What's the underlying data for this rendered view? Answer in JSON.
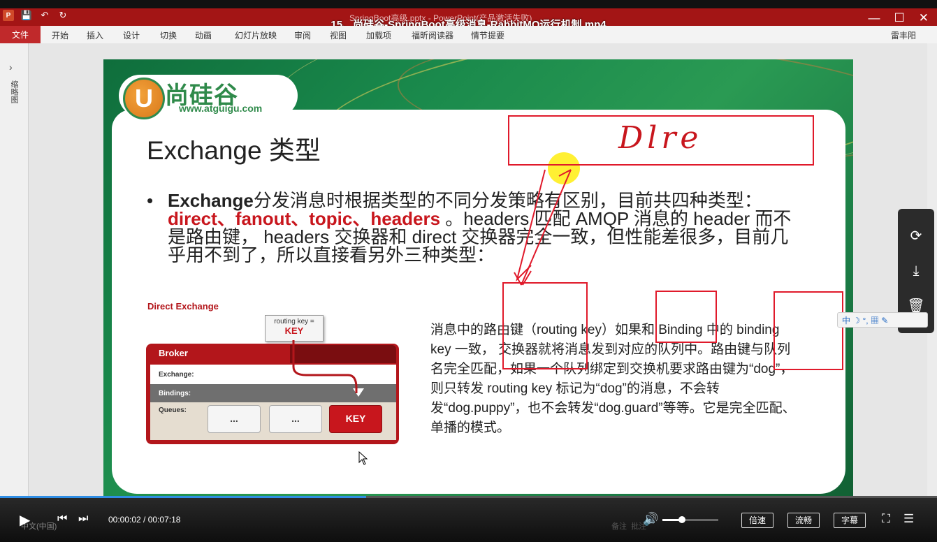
{
  "player": {
    "video_title": "15、尚硅谷-SpringBoot高级消息-RabbitMQ运行机制.mp4",
    "time_current": "00:00:02",
    "time_total": "00:07:18",
    "time_display": "00:00:02 / 00:07:18",
    "progress_fraction": 0.0046,
    "volume_fraction": 0.35,
    "speed_label": "倍速",
    "quality_label": "流畅",
    "subtitle_label": "字幕",
    "side_icons": [
      "share-icon",
      "download-icon",
      "trash-icon"
    ]
  },
  "ppt": {
    "doc_title": "SpringBoot高级.pptx - PowerPoint(产品激活失败)",
    "file_tab": "文件",
    "tabs": [
      "开始",
      "插入",
      "设计",
      "切换",
      "动画",
      "幻灯片放映",
      "审阅",
      "视图",
      "加载项",
      "福昕阅读器",
      "情节提要"
    ],
    "user": "雷丰阳",
    "thumbnail_label": "缩略图",
    "status_lang": "中文(中国)",
    "status_notes": "备注",
    "status_comments": "批注",
    "ime_text": "中"
  },
  "slide": {
    "logo_cn": "尚硅谷",
    "logo_url": "www.atguigu.com",
    "logo_letter": "U",
    "title": "Exchange 类型",
    "bullet_bold": "Exchange",
    "bullet_part1": "分发消息时根据类型的不同分发策略有区别，目前共四种类型：",
    "bullet_red": "direct、fanout、topic、headers",
    "bullet_part2": " 。headers 匹配 AMQP 消息的 header 而不是路由键， headers 交换器和 direct 交换器完全一致，但性能差很多，目前几乎用不到了，所以直接看另外三种类型：",
    "direct_label": "Direct Exchange",
    "routing_key_label": "routing key =",
    "routing_key_value": "KEY",
    "broker_label": "Broker",
    "exchange_label": "Exchange:",
    "bindings_label": "Bindings:",
    "queues_label": "Queues:",
    "queue1": "...",
    "queue2": "...",
    "queue3": "KEY",
    "paragraph": "消息中的路由键（routing key）如果和 Binding 中的 binding key 一致， 交换器就将消息发到对应的队列中。路由键与队列名完全匹配，如果一个队列绑定到交换机要求路由键为“dog”，则只转发 routing key 标记为“dog”的消息，不会转发“dog.puppy”，也不会转发“dog.guard”等等。它是完全匹配、单播的模式。",
    "handwriting": "Dlre"
  }
}
